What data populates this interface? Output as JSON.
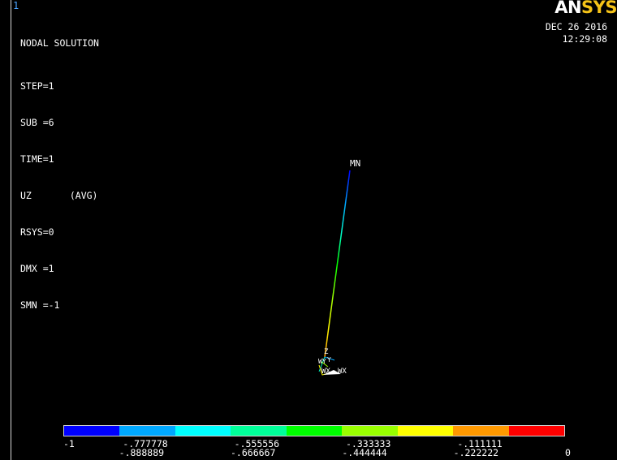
{
  "window": {
    "number": "1"
  },
  "solution": {
    "title": "NODAL SOLUTION",
    "step": "STEP=1",
    "sub": "SUB =6",
    "time": "TIME=1",
    "item": "UZ",
    "avg": "(AVG)",
    "rsys": "RSYS=0",
    "dmx": "DMX =1",
    "smn": "SMN =-1"
  },
  "branding": {
    "logo_main": "AN",
    "logo_accent": "SYS",
    "date": "DEC 26 2016",
    "time": "12:29:08"
  },
  "model": {
    "min_label": "MN",
    "triad_labels": [
      "Z",
      "Y",
      "X"
    ],
    "x_axis_label": "X",
    "node_labels": [
      "WY",
      "WX",
      "WX"
    ]
  },
  "legend": {
    "colors": [
      "#0000ff",
      "#00a8ff",
      "#00ffff",
      "#00ff99",
      "#00ff00",
      "#99ff00",
      "#ffff00",
      "#ff9900",
      "#ff0000"
    ],
    "upper_labels": [
      "-1",
      "-.777778",
      "-.555556",
      "-.333333",
      "-.111111"
    ],
    "lower_labels": [
      "-.888889",
      "-.666667",
      "-.444444",
      "-.222222",
      "0"
    ]
  }
}
